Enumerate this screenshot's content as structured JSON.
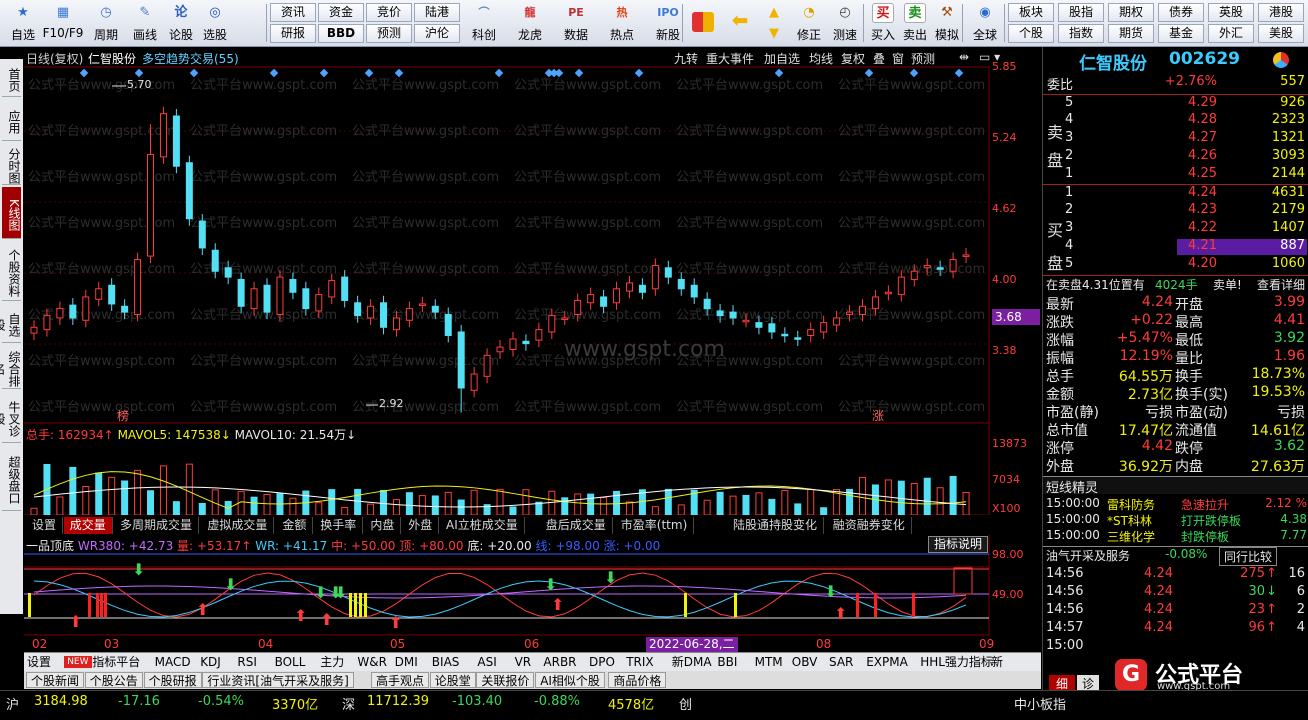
{
  "toolbar": {
    "left_items": [
      {
        "label": "自选",
        "icon": "star-icon"
      },
      {
        "label": "F10/F9",
        "icon": "grid-icon"
      },
      {
        "label": "周期",
        "icon": "clock-icon"
      },
      {
        "label": "画线",
        "icon": "pen-icon"
      },
      {
        "label": "论股",
        "icon": "talk-icon"
      },
      {
        "label": "选股",
        "icon": "target-icon"
      }
    ],
    "grid1": [
      [
        "资讯",
        "资金",
        "竞价",
        "陆港"
      ],
      [
        "研报",
        "BBD",
        "预测",
        "沪伦"
      ]
    ],
    "mid_items": [
      {
        "label": "科创",
        "icon": "chart-icon"
      },
      {
        "label": "龙虎",
        "icon": "dragon-icon"
      },
      {
        "label": "数据",
        "icon": "pe-icon"
      },
      {
        "label": "热点",
        "icon": "hot-icon"
      },
      {
        "label": "新股",
        "icon": "ipo-icon"
      }
    ],
    "right_items": [
      {
        "label": "修正",
        "icon": "correct-icon"
      },
      {
        "label": "测速",
        "icon": "speed-icon"
      },
      {
        "label": "买入",
        "icon": "buy-icon",
        "glyph": "买"
      },
      {
        "label": "卖出",
        "icon": "sell-icon",
        "glyph": "卖"
      },
      {
        "label": "模拟",
        "icon": "hammer-icon"
      },
      {
        "label": "全球",
        "icon": "globe-icon"
      }
    ],
    "grid2": [
      [
        "板块",
        "股指",
        "期权",
        "债券",
        "英股",
        "港股"
      ],
      [
        "个股",
        "指数",
        "期货",
        "基金",
        "外汇",
        "美股"
      ]
    ]
  },
  "sidebar": [
    "首页",
    "应用",
    "分时图",
    "K线图",
    "个股资料",
    "自选股",
    "综合排名",
    "牛叉诊股",
    "超级盘口"
  ],
  "chart": {
    "topbar_left": [
      "日线(复权)",
      "仁智股份",
      "多空趋势交易(55)"
    ],
    "topbar_right": [
      "九转",
      "重大事件",
      "加自选",
      "均线",
      "复权",
      "叠",
      "窗",
      "预测"
    ],
    "price_axis": [
      "5.85",
      "5.24",
      "4.62",
      "4.00",
      "3.38"
    ],
    "current_price": "3.68",
    "hi_label": "5.70",
    "lo_label": "2.92",
    "marker_bang": "榜",
    "marker_zhang": "涨",
    "watermark": "公式平台www.gspt.com",
    "watermark2": "www.gspt.com",
    "vol_legend": {
      "total": "总手: ",
      "total_val": "162934↑",
      "mavol5": "MAVOL5: 147538↓",
      "mavol10": "MAVOL10: 21.54万↓"
    },
    "vol_axis": [
      "13873",
      "7034",
      "X100"
    ],
    "vol_tabs": [
      "设置",
      "成交量",
      "多周期成交量",
      "虚拟成交量",
      "金额",
      "换手率",
      "内盘",
      "外盘",
      "AI立桩成交量",
      "盘后成交量",
      "市盈率(ttm)",
      "陆股通持股变化",
      "融资融券变化"
    ],
    "ind_legend": {
      "name": "一品顶底",
      "wr380": "WR380: +42.73",
      "liang": "量: +53.17↑",
      "wr": "WR: +41.17",
      "zhong": "中: +50.00",
      "ding": "顶: +80.00",
      "di": "底: +20.00",
      "vvx": "线: +98.00",
      "zhang": "涨: +0.00"
    },
    "ind_help": "指标说明",
    "ind_axis": [
      "98.00",
      "49.00"
    ],
    "x_axis": [
      "02",
      "03",
      "04",
      "05",
      "06",
      "07",
      "08",
      "09"
    ],
    "date_label": "2022-06-28,二"
  },
  "chart_data": {
    "type": "candlestick",
    "ohlc_close_approx": [
      3.62,
      3.72,
      3.78,
      3.7,
      3.88,
      3.95,
      3.82,
      3.75,
      4.2,
      5.1,
      5.45,
      5.0,
      4.55,
      4.3,
      4.1,
      4.05,
      3.8,
      3.95,
      3.75,
      4.05,
      3.92,
      3.78,
      3.9,
      4.02,
      3.85,
      3.72,
      3.8,
      3.62,
      3.7,
      3.78,
      3.82,
      3.75,
      3.55,
      3.1,
      3.22,
      3.38,
      3.45,
      3.52,
      3.48,
      3.6,
      3.72,
      3.7,
      3.85,
      3.9,
      3.8,
      3.95,
      4.0,
      3.92,
      4.15,
      4.05,
      3.95,
      3.88,
      3.78,
      3.72,
      3.7,
      3.68,
      3.62,
      3.58,
      3.55,
      3.52,
      3.6,
      3.66,
      3.7,
      3.75,
      3.8,
      3.88,
      3.92,
      4.05,
      4.1,
      4.15,
      4.12,
      4.2,
      4.24
    ],
    "ylim": [
      2.92,
      5.85
    ]
  },
  "indicators": {
    "tabs": [
      "设置",
      "NEW",
      "指标平台",
      "MACD",
      "KDJ",
      "RSI",
      "BOLL",
      "主力",
      "W&R",
      "DMI",
      "BIAS",
      "ASI",
      "VR",
      "ARBR",
      "DPO",
      "TRIX",
      "新DMA",
      "BBI",
      "MTM",
      "OBV",
      "SAR",
      "EXPMA",
      "HHL强力指标",
      "新"
    ],
    "news_tabs": [
      "个股新闻",
      "个股公告",
      "个股研报",
      "行业资讯[油气开采及服务]",
      "高手观点",
      "论股堂",
      "关联报价",
      "AI相似个股",
      "商品价格"
    ]
  },
  "status": {
    "sh_label": "沪",
    "sh_index": "3184.98",
    "sh_chg": "-17.16",
    "sh_pct": "-0.54%",
    "sh_amt": "3370亿",
    "sz_label": "深",
    "sz_index": "11712.39",
    "sz_chg": "-103.40",
    "sz_pct": "-0.88%",
    "sz_amt": "4578亿",
    "cy_label": "创",
    "board": "中小板指"
  },
  "quote": {
    "name": "仁智股份",
    "code": "002629",
    "weibi_label": "委比",
    "weibi_val": "+2.76%",
    "weibi_vol": "557",
    "sell_label": [
      "卖",
      "盘"
    ],
    "buy_label": [
      "买",
      "盘"
    ],
    "sell": [
      [
        "5",
        "4.29",
        "926"
      ],
      [
        "4",
        "4.28",
        "2323"
      ],
      [
        "3",
        "4.27",
        "1321"
      ],
      [
        "2",
        "4.26",
        "3093"
      ],
      [
        "1",
        "4.25",
        "2144"
      ]
    ],
    "buy": [
      [
        "1",
        "4.24",
        "4631"
      ],
      [
        "2",
        "4.23",
        "2179"
      ],
      [
        "3",
        "4.22",
        "1407"
      ],
      [
        "4",
        "4.21",
        "887"
      ],
      [
        "5",
        "4.20",
        "1060"
      ]
    ],
    "notice": "在卖盘4.31位置有",
    "notice_vol": "4024手",
    "notice_tail": "卖单!",
    "notice_link": "查看详细",
    "stats": [
      [
        "最新",
        "4.24",
        "开盘",
        "3.99"
      ],
      [
        "涨跌",
        "+0.22",
        "最高",
        "4.41"
      ],
      [
        "涨幅",
        "+5.47%",
        "最低",
        "3.92"
      ],
      [
        "振幅",
        "12.19%",
        "量比",
        "1.96"
      ],
      [
        "总手",
        "64.55万",
        "换手",
        "18.73%"
      ],
      [
        "金额",
        "2.73亿",
        "换手(实)",
        "19.53%"
      ],
      [
        "市盈(静)",
        "亏损",
        "市盈(动)",
        "亏损"
      ],
      [
        "总市值",
        "17.47亿",
        "流通值",
        "14.61亿"
      ],
      [
        "涨停",
        "4.42",
        "跌停",
        "3.62"
      ],
      [
        "外盘",
        "36.92万",
        "内盘",
        "27.63万"
      ]
    ],
    "duanxian_title": "短线精灵",
    "duanxian": [
      [
        "15:00:00",
        "雷科防务",
        "急速拉升",
        "2.12 %"
      ],
      [
        "15:00:00",
        "*ST科林",
        "打开跌停板",
        "4.38"
      ],
      [
        "15:00:00",
        "三维化学",
        "封跌停板",
        "7.77"
      ]
    ],
    "sector": "油气开采及服务",
    "sector_pct": "-0.08%",
    "sector_btn": "同行比较",
    "ticks": [
      [
        "14:56",
        "4.24",
        "275",
        "16"
      ],
      [
        "14:56",
        "4.24",
        "30",
        "6"
      ],
      [
        "14:56",
        "4.24",
        "23",
        "2"
      ],
      [
        "14:57",
        "4.24",
        "96",
        "4"
      ],
      [
        "15:00",
        "",
        "",
        ""
      ]
    ],
    "tab_xi": "细",
    "tab_zhen": "诊",
    "logo_text": "公式平台",
    "logo_url": "www.gspt.com"
  }
}
